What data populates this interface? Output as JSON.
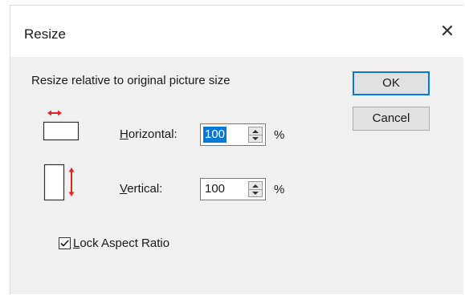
{
  "window": {
    "title": "Resize",
    "close_glyph": "✕"
  },
  "instruction": "Resize relative to original picture size",
  "buttons": {
    "ok": "OK",
    "cancel": "Cancel"
  },
  "horizontal": {
    "label_accel": "H",
    "label_rest": "orizontal:",
    "value": "100",
    "unit": "%",
    "icon": "horizontal-resize-icon"
  },
  "vertical": {
    "label_accel": "V",
    "label_rest": "ertical:",
    "value": "100",
    "unit": "%",
    "icon": "vertical-resize-icon"
  },
  "lock": {
    "label_accel": "L",
    "label_rest": "ock Aspect Ratio",
    "checked": true
  },
  "colors": {
    "accent": "#0078d7",
    "arrow": "#e0242a",
    "dialog_bg": "#f0f0f0"
  }
}
